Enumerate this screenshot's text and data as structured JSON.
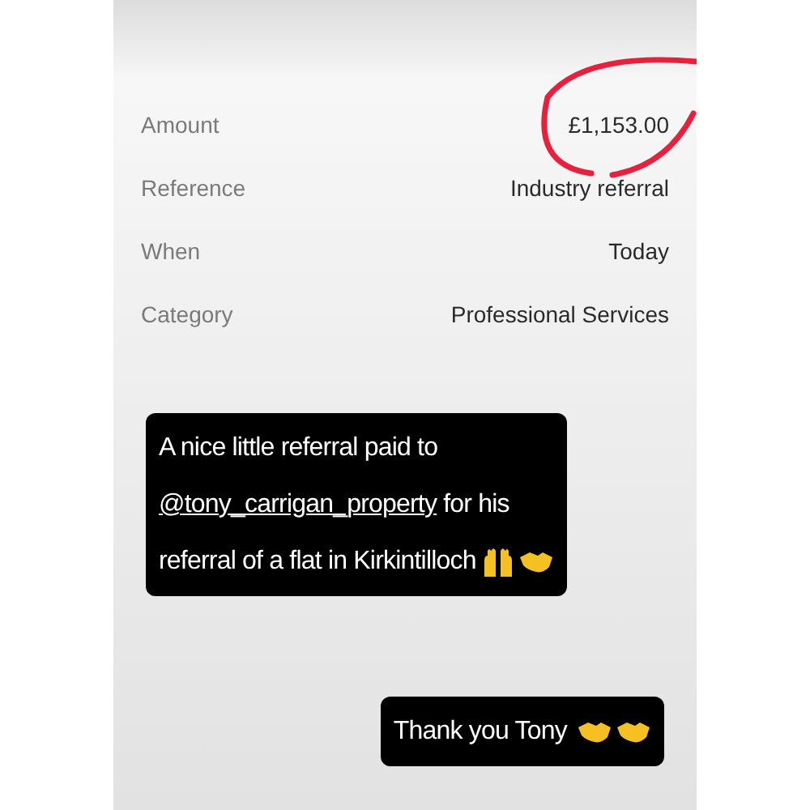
{
  "details": [
    {
      "label": "Amount",
      "value": "£1,153.00",
      "circled": true
    },
    {
      "label": "Reference",
      "value": "Industry referral",
      "circled": false
    },
    {
      "label": "When",
      "value": "Today",
      "circled": false
    },
    {
      "label": "Category",
      "value": "Professional Services",
      "circled": false
    }
  ],
  "captions": [
    {
      "lines": [
        [
          {
            "kind": "text",
            "text": "A nice little referral paid to"
          }
        ],
        [
          {
            "kind": "mention",
            "text": "@tony_carrigan_property"
          },
          {
            "kind": "text",
            "text": " for his"
          }
        ],
        [
          {
            "kind": "text",
            "text": "referral of a flat in Kirkintilloch"
          }
        ]
      ]
    },
    {
      "lines": [
        [
          {
            "kind": "text",
            "text": "Thank you Tony"
          }
        ]
      ]
    }
  ]
}
